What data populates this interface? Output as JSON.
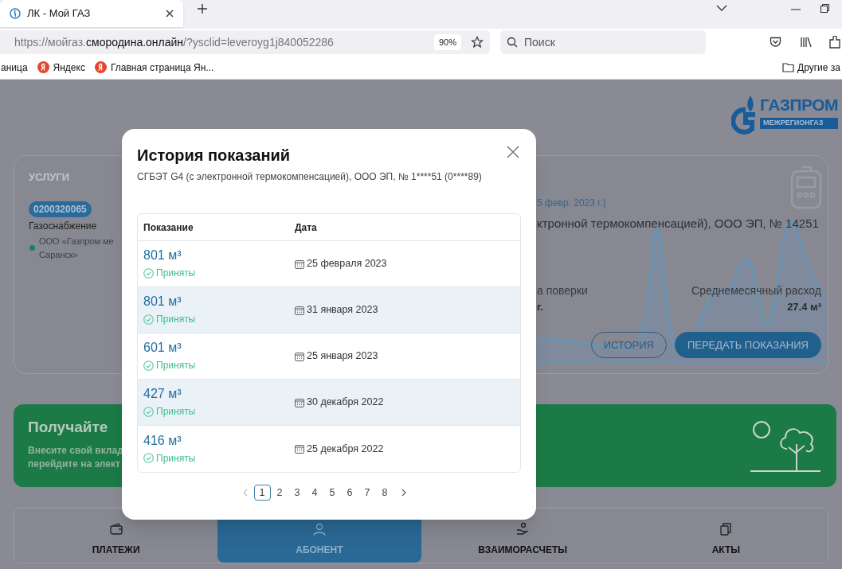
{
  "browser": {
    "tab": {
      "title": "ЛК - Мой ГАЗ"
    },
    "address": {
      "url_start": "https://мойгаз.",
      "url_host": "смородина.онлайн",
      "url_rest": "/?ysclid=leveroyg1j840052286",
      "zoom": "90%"
    },
    "search": {
      "placeholder": "Поиск"
    },
    "bookmarks": [
      {
        "label": "аница",
        "kind": "plain"
      },
      {
        "label": "Яндекс",
        "kind": "yandex"
      },
      {
        "label": "Главная страница Ян...",
        "kind": "yandex"
      }
    ],
    "other_bookmarks": "Другие за"
  },
  "page": {
    "logo": {
      "name": "ГАЗПРОМ",
      "sub": "МЕЖРЕГИОНГАЗ"
    },
    "services": {
      "heading": "УСЛУГИ",
      "account": "0200320065",
      "service": "Газоснабжение",
      "provider_lines": [
        "ООО «Газпром ме",
        "Саранск»"
      ]
    },
    "meter": {
      "date": "5 февр. 2023 г.)",
      "model": "ктронной термокомпенсацией), ООО ЭП, № 14251",
      "verification_label": "а поверки",
      "verification_value": "г.",
      "consumption_label": "Среднемесячный расход",
      "consumption_value": "27.4 м³",
      "buttons": [
        {
          "label": "ИСТОРИЯ",
          "kind": "outline"
        },
        {
          "label": "ПЕРЕДАТЬ ПОКАЗАНИЯ",
          "kind": "primary"
        }
      ]
    },
    "banner": {
      "title": "Получайте",
      "lines": [
        "Внесите свой вклад",
        "перейдите на элект"
      ]
    },
    "nav": [
      {
        "label": "ПЛАТЕЖИ",
        "selected": false
      },
      {
        "label": "АБОНЕНТ",
        "selected": true
      },
      {
        "label": "ВЗАИМОРАСЧЕТЫ",
        "selected": false
      },
      {
        "label": "АКТЫ",
        "selected": false
      }
    ]
  },
  "modal": {
    "title": "История показаний",
    "subtitle": "СГБЭТ G4 (с электронной термокомпенсацией), ООО ЭП, № 1****51 (0****89)",
    "columns": [
      "Показание",
      "Дата"
    ],
    "rows": [
      {
        "value": "801 м³",
        "status": "Приняты",
        "date": "25 февраля 2023"
      },
      {
        "value": "801 м³",
        "status": "Приняты",
        "date": "31 января 2023"
      },
      {
        "value": "601 м³",
        "status": "Приняты",
        "date": "25 января 2023"
      },
      {
        "value": "427 м³",
        "status": "Приняты",
        "date": "30 декабря 2022"
      },
      {
        "value": "416 м³",
        "status": "Приняты",
        "date": "25 декабря 2022"
      }
    ],
    "pages": [
      {
        "label": "1",
        "selected": true
      },
      {
        "label": "2",
        "selected": false
      },
      {
        "label": "3",
        "selected": false
      },
      {
        "label": "4",
        "selected": false
      },
      {
        "label": "5",
        "selected": false
      },
      {
        "label": "6",
        "selected": false
      },
      {
        "label": "7",
        "selected": false
      },
      {
        "label": "8",
        "selected": false
      }
    ]
  }
}
